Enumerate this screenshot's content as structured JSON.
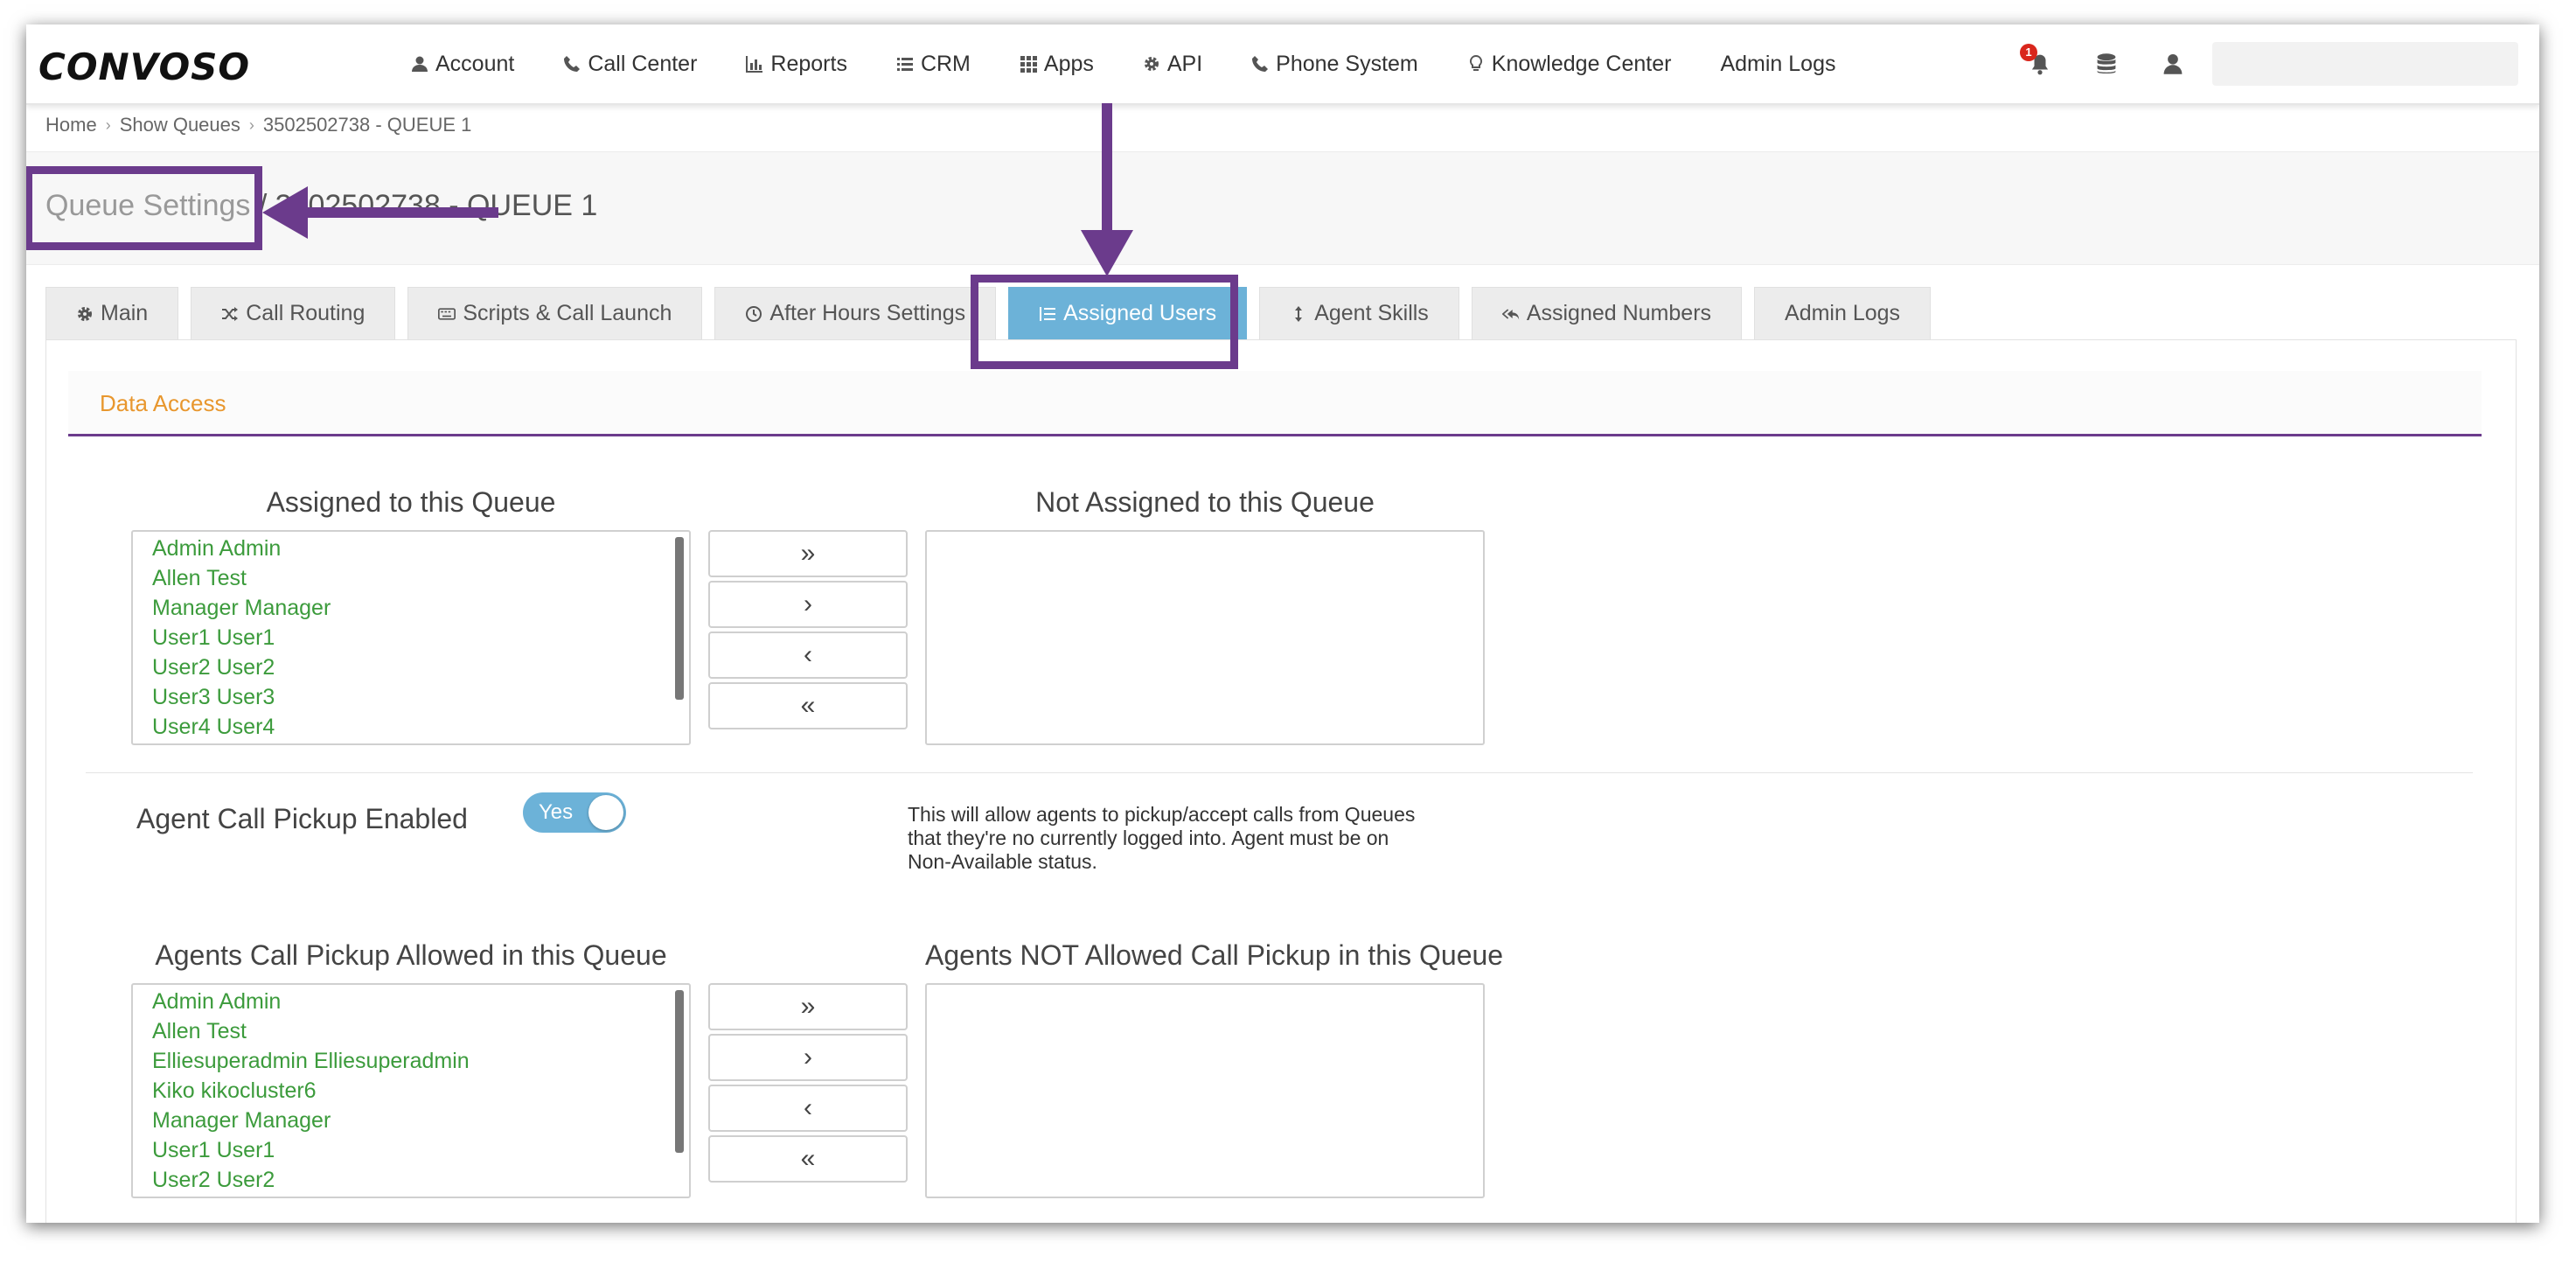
{
  "app": {
    "logo": "CONVOSO"
  },
  "nav": {
    "items": [
      {
        "label": "Account",
        "icon": "user-icon"
      },
      {
        "label": "Call Center",
        "icon": "phone-icon"
      },
      {
        "label": "Reports",
        "icon": "bar-chart-icon"
      },
      {
        "label": "CRM",
        "icon": "list-icon"
      },
      {
        "label": "Apps",
        "icon": "grid-icon"
      },
      {
        "label": "API",
        "icon": "gear-icon"
      },
      {
        "label": "Phone System",
        "icon": "phone-icon"
      },
      {
        "label": "Knowledge Center",
        "icon": "lightbulb-icon"
      },
      {
        "label": "Admin Logs",
        "icon": ""
      }
    ],
    "notification_count": "1"
  },
  "breadcrumb": [
    "Home",
    "Show Queues",
    "3502502738 - QUEUE 1"
  ],
  "page": {
    "title_prefix": "Queue Settings",
    "title_rest": "/ 3502502738 - QUEUE 1"
  },
  "tabs": [
    {
      "label": "Main",
      "icon": "gear-icon"
    },
    {
      "label": "Call Routing",
      "icon": "shuffle-icon"
    },
    {
      "label": "Scripts & Call Launch",
      "icon": "keyboard-icon"
    },
    {
      "label": "After Hours Settings",
      "icon": "clock-icon"
    },
    {
      "label": "Assigned Users",
      "icon": "ordered-list-icon",
      "active": true
    },
    {
      "label": "Agent Skills",
      "icon": "vertical-arrows-icon"
    },
    {
      "label": "Assigned Numbers",
      "icon": "reply-all-icon"
    },
    {
      "label": "Admin Logs",
      "icon": ""
    }
  ],
  "section": {
    "title": "Data Access"
  },
  "assigned": {
    "left_title": "Assigned to this Queue",
    "right_title": "Not Assigned to this Queue",
    "left_items": [
      "Admin Admin",
      "Allen Test",
      "Manager Manager",
      "User1 User1",
      "User2 User2",
      "User3 User3",
      "User4 User4"
    ],
    "right_items": []
  },
  "transfer_buttons": [
    "»",
    "›",
    "‹",
    "«"
  ],
  "pickup": {
    "label": "Agent Call Pickup Enabled",
    "toggle_text": "Yes",
    "toggle_on": true,
    "help_lines": [
      "This will allow agents to pickup/accept calls from Queues",
      "that they're no currently logged into. Agent must be on",
      "Non-Available status."
    ]
  },
  "pickup_lists": {
    "left_title": "Agents Call Pickup Allowed in this Queue",
    "right_title": "Agents NOT Allowed Call Pickup in this Queue",
    "left_items": [
      "Admin Admin",
      "Allen Test",
      "Elliesuperadmin Elliesuperadmin",
      "Kiko kikocluster6",
      "Manager Manager",
      "User1 User1",
      "User2 User2"
    ],
    "right_items": []
  },
  "colors": {
    "accent": "#6cb2d8",
    "annotation": "#6b3b8c",
    "section_title": "#e8972e",
    "list_text": "#3c9b3c"
  }
}
